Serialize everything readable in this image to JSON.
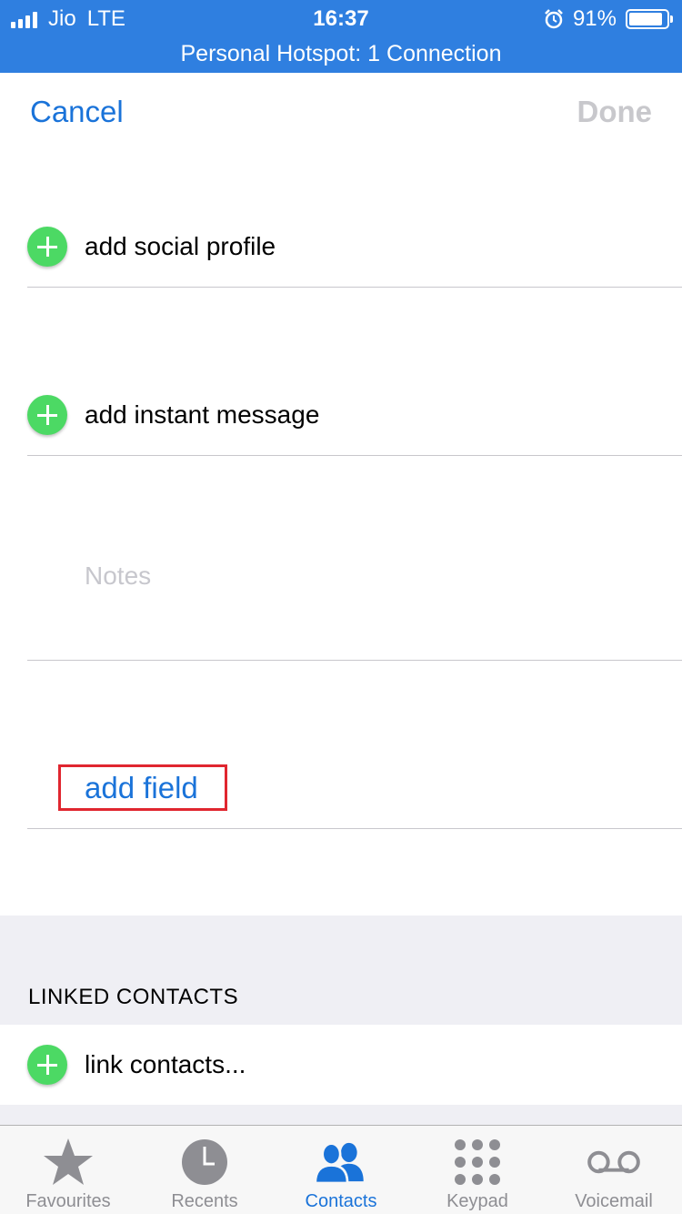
{
  "status_bar": {
    "carrier": "Jio",
    "network": "LTE",
    "time": "16:37",
    "battery": "91%",
    "battery_level": 0.91,
    "hotspot": "Personal Hotspot: 1 Connection"
  },
  "nav": {
    "cancel_label": "Cancel",
    "done_label": "Done"
  },
  "rows": {
    "social_profile": "add social profile",
    "instant_message": "add instant message",
    "notes_placeholder": "Notes",
    "add_field": "add field"
  },
  "linked": {
    "header": "LINKED CONTACTS",
    "link_label": "link contacts..."
  },
  "tabs": [
    {
      "label": "Favourites",
      "icon": "star-icon"
    },
    {
      "label": "Recents",
      "icon": "clock-icon"
    },
    {
      "label": "Contacts",
      "icon": "contacts-icon",
      "active": true
    },
    {
      "label": "Keypad",
      "icon": "keypad-icon"
    },
    {
      "label": "Voicemail",
      "icon": "voicemail-icon"
    }
  ],
  "colors": {
    "status_bar": "#2f7fe0",
    "accent": "#1a73d9",
    "add_button": "#4cd964",
    "highlight_box": "#e0262f",
    "tab_inactive": "#8e8e93"
  }
}
